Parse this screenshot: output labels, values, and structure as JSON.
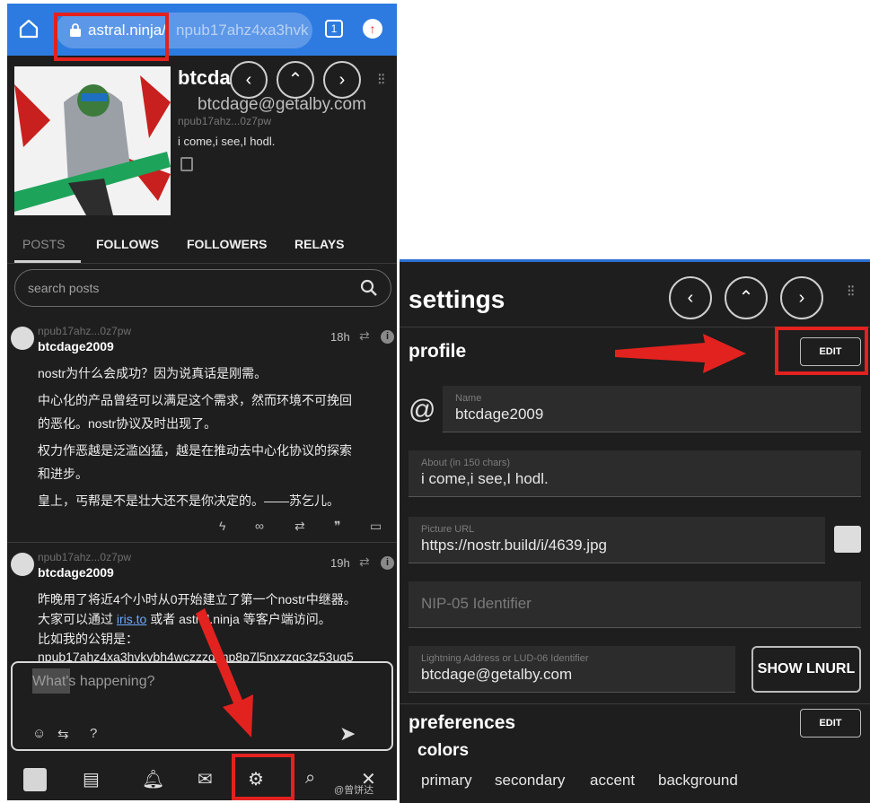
{
  "browser": {
    "url_host": "astral.ninja/",
    "url_path": "npub17ahz4xa3hvk",
    "tab_count": "1"
  },
  "profile": {
    "name": "btcdage2009",
    "name_visible": "btcdag",
    "nip05": "btcdage@getalby.com",
    "npub": "npub17ahz...0z7pw",
    "about": "i come,i see,I hodl."
  },
  "nav": {
    "back": "‹",
    "top": "⌃",
    "forward": "›"
  },
  "tabs": [
    "POSTS",
    "FOLLOWS",
    "FOLLOWERS",
    "RELAYS"
  ],
  "search": {
    "placeholder": "search posts"
  },
  "posts": [
    {
      "npub": "npub17ahz...0z7pw",
      "author": "btcdage2009",
      "time": "18h",
      "lines": [
        "nostr为什么会成功？因为说真话是刚需。",
        "中心化的产品曾经可以满足这个需求，然而环境不可挽回",
        "的恶化。nostr协议及时出现了。",
        "权力作恶越是泛滥凶猛，越是在推动去中心化协议的探索",
        "和进步。",
        "皇上，丐帮是不是壮大还不是你决定的。——苏乞儿。"
      ]
    },
    {
      "npub": "npub17ahz...0z7pw",
      "author": "btcdage2009",
      "time": "19h",
      "line1": "昨晚用了将近4个小时从0开始建立了第一个nostr中继器。",
      "line2_a": "大家可以通过 ",
      "line2_link": "iris.to",
      "line2_b": " 或者 astral.ninja 等客户端访问。",
      "line3": "比如我的公钥是：",
      "line4": "npub17ahz4xa3hvkvbh4wczzzqknp8p7l5nxzzqc3z53uq5"
    }
  ],
  "compose": {
    "placeholder": "What's happening?"
  },
  "watermark": "@曾饼达",
  "settings": {
    "title": "settings",
    "profile_heading": "profile",
    "edit_label": "EDIT",
    "fields": {
      "name_label": "Name",
      "name_value": "btcdage2009",
      "about_label": "About (in 150 chars)",
      "about_value": "i come,i see,I hodl.",
      "picture_label": "Picture URL",
      "picture_value": "https://nostr.build/i/4639.jpg",
      "nip05_placeholder": "NIP-05 Identifier",
      "lightning_label": "Lightning Address or LUD-06 Identifier",
      "lightning_value": "btcdage@getalby.com"
    },
    "show_lnurl": "SHOW LNURL",
    "preferences_heading": "preferences",
    "colors_heading": "colors",
    "colors": [
      "primary",
      "secondary",
      "accent",
      "background"
    ]
  },
  "colors": {
    "brand": "#2d7be0",
    "highlight": "#e2221f",
    "bg": "#1e1e1e"
  }
}
